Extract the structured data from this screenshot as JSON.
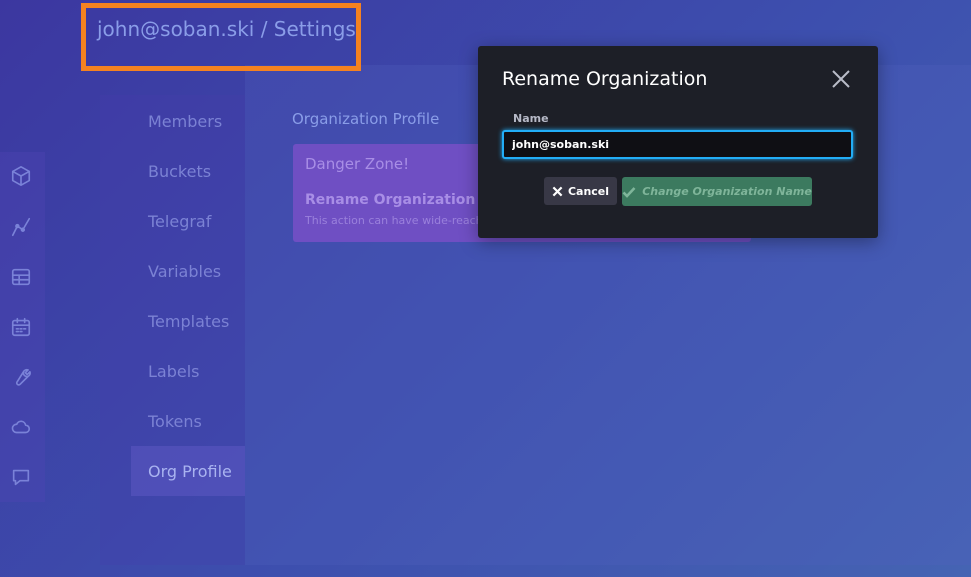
{
  "header": {
    "title": "john@soban.ski / Settings"
  },
  "nav_icons": [
    "cube-icon",
    "graph-icon",
    "table-icon",
    "calendar-icon",
    "wrench-icon",
    "cloud-icon",
    "chat-icon"
  ],
  "tabs": [
    {
      "label": "Members"
    },
    {
      "label": "Buckets"
    },
    {
      "label": "Telegraf"
    },
    {
      "label": "Variables"
    },
    {
      "label": "Templates"
    },
    {
      "label": "Labels"
    },
    {
      "label": "Tokens"
    },
    {
      "label": "Org Profile",
      "active": true
    }
  ],
  "main": {
    "section_title": "Organization Profile",
    "danger_zone": {
      "title": "Danger Zone!",
      "rename_title": "Rename Organization",
      "rename_desc": "This action can have wide-reaching"
    }
  },
  "modal": {
    "title": "Rename Organization",
    "field_label": "Name",
    "field_value": "john@soban.ski",
    "cancel_label": "Cancel",
    "submit_label": "Change Organization Name"
  },
  "colors": {
    "highlight_box": "#f58220",
    "input_focus": "#22adf6",
    "submit_button": "#3c7a5f"
  }
}
